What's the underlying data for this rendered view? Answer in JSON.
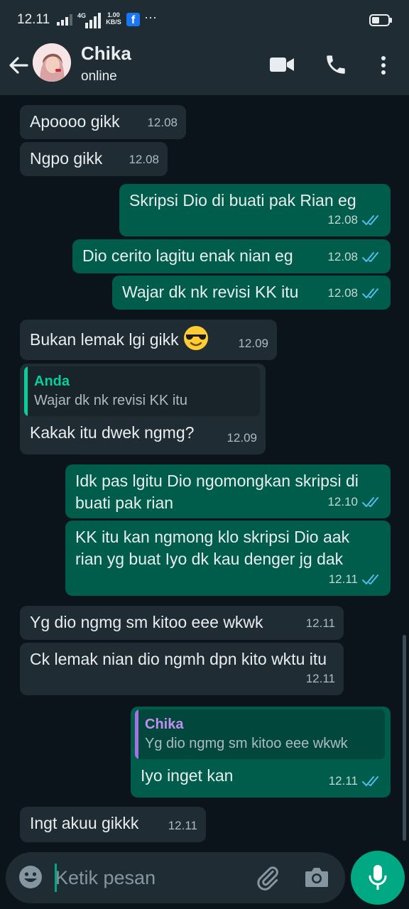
{
  "status_bar": {
    "time": "12.11",
    "network": "4G",
    "speed_value": "1.00",
    "speed_unit": "KB/S",
    "notification_icon": "facebook-icon",
    "more": "···"
  },
  "header": {
    "contact_name": "Chika",
    "status": "online"
  },
  "messages": [
    {
      "dir": "in",
      "text": "Apoooo gikk",
      "time": "12.08"
    },
    {
      "dir": "in",
      "text": "Ngpo gikk",
      "time": "12.08"
    },
    {
      "dir": "out",
      "text": "Skripsi Dio di buati pak Rian eg",
      "time": "12.08",
      "status": "read"
    },
    {
      "dir": "out",
      "text": "Dio cerito lagitu enak nian eg",
      "time": "12.08",
      "status": "read"
    },
    {
      "dir": "out",
      "text": "Wajar dk nk revisi KK itu",
      "time": "12.08",
      "status": "read"
    },
    {
      "dir": "in",
      "text": "Bukan lemak lgi gikk",
      "emoji": "smiling-face-with-sunglasses",
      "time": "12.09"
    },
    {
      "dir": "in",
      "quote_author": "Anda",
      "quote_text": "Wajar dk nk revisi KK itu",
      "text": "Kakak itu dwek ngmg?",
      "time": "12.09"
    },
    {
      "dir": "out",
      "text": "Idk pas lgitu Dio ngomongkan skripsi di buati pak rian",
      "time": "12.10",
      "status": "read"
    },
    {
      "dir": "out",
      "text": "KK itu kan ngmong klo skripsi Dio aak rian yg buat Iyo dk kau denger jg dak",
      "time": "12.11",
      "status": "read"
    },
    {
      "dir": "in",
      "text": "Yg dio ngmg sm kitoo eee wkwk",
      "time": "12.11"
    },
    {
      "dir": "in",
      "text": "Ck lemak nian dio ngmh dpn kito wktu itu",
      "time": "12.11"
    },
    {
      "dir": "out",
      "quote_author": "Chika",
      "quote_text": "Yg dio ngmg sm kitoo eee wkwk",
      "text": "Iyo inget kan",
      "time": "12.11",
      "status": "read"
    },
    {
      "dir": "in",
      "text": "Ingt akuu gikkk",
      "time": "12.11"
    }
  ],
  "composer": {
    "placeholder": "Ketik pesan"
  },
  "colors": {
    "background": "#0b141a",
    "incoming_bubble": "#1f2c34",
    "outgoing_bubble": "#005c4b",
    "accent": "#00a884",
    "read_tick": "#53bdeb"
  }
}
